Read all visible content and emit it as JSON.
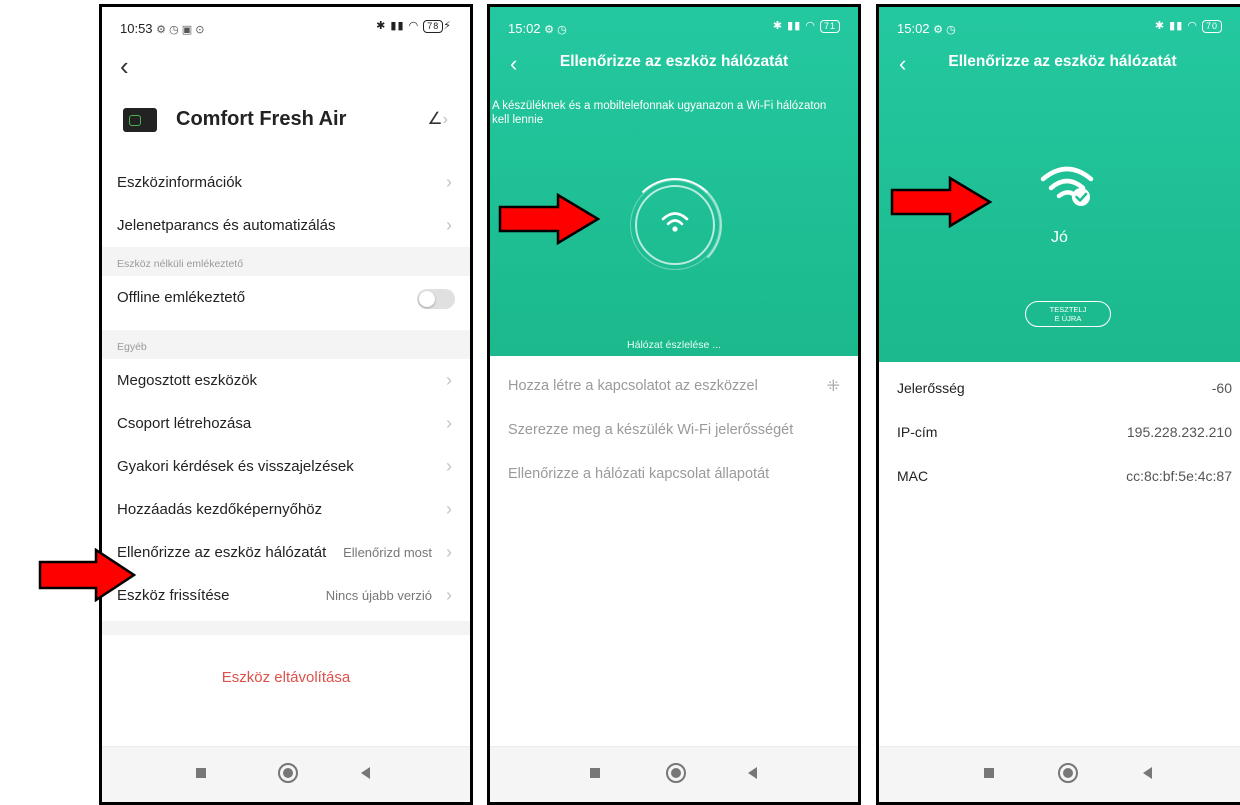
{
  "phone1": {
    "status": {
      "time": "10:53",
      "battery": "78"
    },
    "device_name": "Comfort  Fresh Air",
    "rows_a": [
      {
        "label": "Eszközinformációk"
      },
      {
        "label": "Jelenetparancs és automatizálás"
      }
    ],
    "section1": "Eszköz nélküli emlékeztető",
    "offline_label": "Offline emlékeztető",
    "section2": "Egyéb",
    "rows_b": [
      {
        "label": "Megosztott eszközök",
        "value": ""
      },
      {
        "label": "Csoport létrehozása",
        "value": ""
      },
      {
        "label": "Gyakori kérdések és visszajelzések",
        "value": ""
      },
      {
        "label": "Hozzáadás kezdőképernyőhöz",
        "value": ""
      },
      {
        "label": "Ellenőrizze az eszköz hálózatát",
        "value": "Ellenőrizd most"
      },
      {
        "label": "Eszköz frissítése",
        "value": "Nincs újabb verzió"
      }
    ],
    "remove_label": "Eszköz eltávolítása",
    "offline_toggle_on": false
  },
  "phone2": {
    "status": {
      "time": "15:02",
      "battery": "71"
    },
    "title": "Ellenőrizze az eszköz hálózatát",
    "description": "A készüléknek és a mobiltelefonnak ugyanazon a Wi-Fi hálózaton kell lennie",
    "detecting": "Hálózat észlelése ...",
    "steps": [
      "Hozza létre a kapcsolatot az eszközzel",
      "Szerezze meg a készülék Wi-Fi jelerősségét",
      "Ellenőrizze a hálózati kapcsolat állapotát"
    ]
  },
  "phone3": {
    "status": {
      "time": "15:02",
      "battery": "70"
    },
    "title": "Ellenőrizze az eszköz hálózatát",
    "quality": "Jó",
    "retest_line1": "TESZTELJ",
    "retest_line2": "E ÚJRA",
    "info": [
      {
        "label": "Jelerősség",
        "value": "-60"
      },
      {
        "label": "IP-cím",
        "value": "195.228.232.210"
      },
      {
        "label": "MAC",
        "value": "cc:8c:bf:5e:4c:87"
      }
    ]
  },
  "colors": {
    "accent_green": "#1fbf94",
    "danger_red": "#e0504a",
    "arrow_red": "#ff0000"
  },
  "icons": [
    "back-chevron-icon",
    "edit-icon",
    "wifi-icon",
    "wifi-check-icon",
    "spinner-icon",
    "nav-recent-icon",
    "nav-home-icon",
    "nav-back-icon"
  ]
}
